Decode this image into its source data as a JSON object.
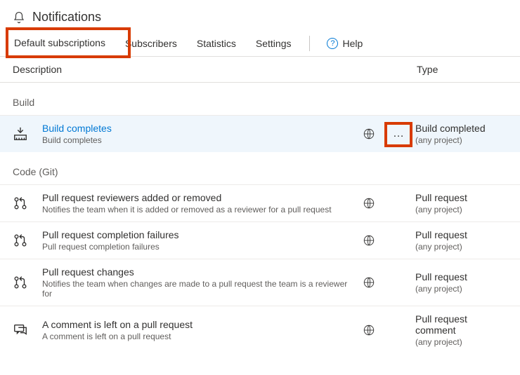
{
  "header": {
    "title": "Notifications"
  },
  "tabs": [
    {
      "label": "Default subscriptions",
      "active": true
    },
    {
      "label": "Subscribers"
    },
    {
      "label": "Statistics"
    },
    {
      "label": "Settings"
    }
  ],
  "help_label": "Help",
  "columns": {
    "description": "Description",
    "type": "Type"
  },
  "sections": [
    {
      "label": "Build",
      "rows": [
        {
          "icon": "build-icon",
          "title": "Build completes",
          "title_link": true,
          "subtitle": "Build completes",
          "show_more": true,
          "selected": true,
          "type_label": "Build completed",
          "type_sub": "(any project)"
        }
      ]
    },
    {
      "label": "Code (Git)",
      "rows": [
        {
          "icon": "pr-icon",
          "title": "Pull request reviewers added or removed",
          "subtitle": "Notifies the team when it is added or removed as a reviewer for a pull request",
          "type_label": "Pull request",
          "type_sub": "(any project)"
        },
        {
          "icon": "pr-icon",
          "title": "Pull request completion failures",
          "subtitle": "Pull request completion failures",
          "type_label": "Pull request",
          "type_sub": "(any project)"
        },
        {
          "icon": "pr-icon",
          "title": "Pull request changes",
          "subtitle": "Notifies the team when changes are made to a pull request the team is a reviewer for",
          "type_label": "Pull request",
          "type_sub": "(any project)"
        },
        {
          "icon": "comment-icon",
          "title": "A comment is left on a pull request",
          "subtitle": "A comment is left on a pull request",
          "type_label": "Pull request comment",
          "type_sub": "(any project)"
        }
      ]
    }
  ]
}
